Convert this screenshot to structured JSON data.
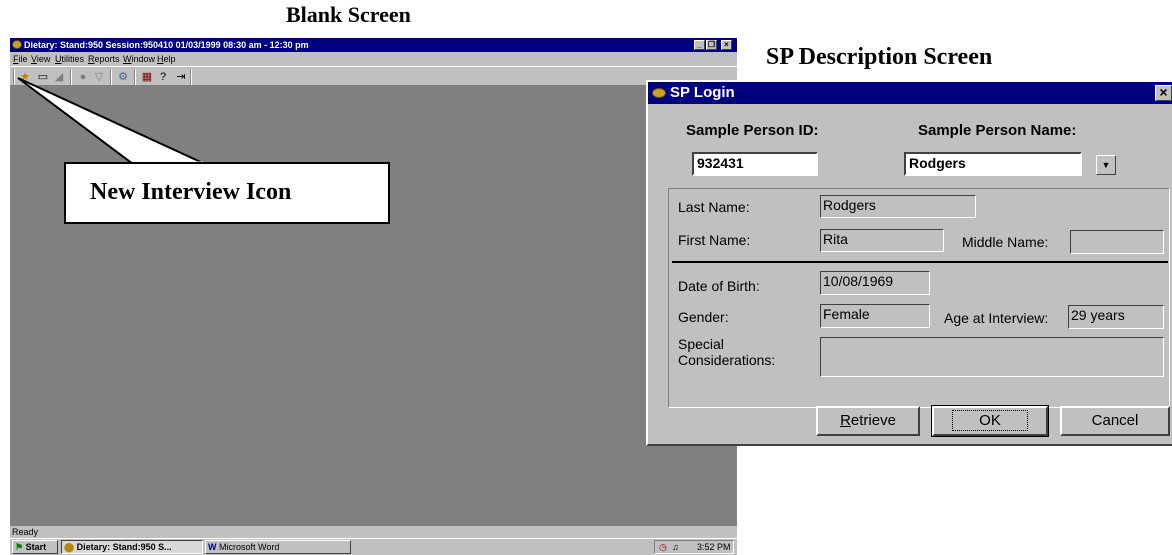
{
  "captions": {
    "blank": "Blank Screen",
    "sp": "SP Description Screen"
  },
  "app": {
    "title": "Dietary: Stand:950 Session:950410 01/03/1999 08:30 am - 12:30 pm",
    "window_buttons": [
      "_",
      "❒",
      "×"
    ],
    "menu": [
      {
        "u": "F",
        "rest": "ile"
      },
      {
        "u": "V",
        "rest": "iew"
      },
      {
        "u": "U",
        "rest": "tilities"
      },
      {
        "u": "R",
        "rest": "eports"
      },
      {
        "u": "W",
        "rest": "indow"
      },
      {
        "u": "H",
        "rest": "elp"
      }
    ],
    "toolbar_icons": [
      "new-interview-icon",
      "clipboard-icon",
      "save-icon",
      "person-icon",
      "filter-icon",
      "tools-icon",
      "chart-icon",
      "help-icon",
      "exit-icon"
    ],
    "status": "Ready"
  },
  "callout": {
    "text": "New Interview Icon"
  },
  "taskbar": {
    "start": "Start",
    "items": [
      "Dietary: Stand:950 S...",
      "Microsoft Word"
    ],
    "clock": "3:52 PM"
  },
  "dialog": {
    "title": "SP Login",
    "close": "×",
    "sp_id_label": "Sample Person ID:",
    "sp_name_label": "Sample Person Name:",
    "sp_id": "932431",
    "sp_name": "Rodgers",
    "last_name_label": "Last Name:",
    "last_name": "Rodgers",
    "first_name_label": "First Name:",
    "first_name": "Rita",
    "middle_name_label": "Middle Name:",
    "middle_name": "",
    "dob_label": "Date of Birth:",
    "dob": "10/08/1969",
    "gender_label": "Gender:",
    "gender": "Female",
    "age_label": "Age at Interview:",
    "age": "29 years",
    "special_label_1": "Special",
    "special_label_2": "Considerations:",
    "special": "",
    "buttons": {
      "retrieve_u": "R",
      "retrieve_rest": "etrieve",
      "ok": "OK",
      "cancel": "Cancel"
    }
  }
}
